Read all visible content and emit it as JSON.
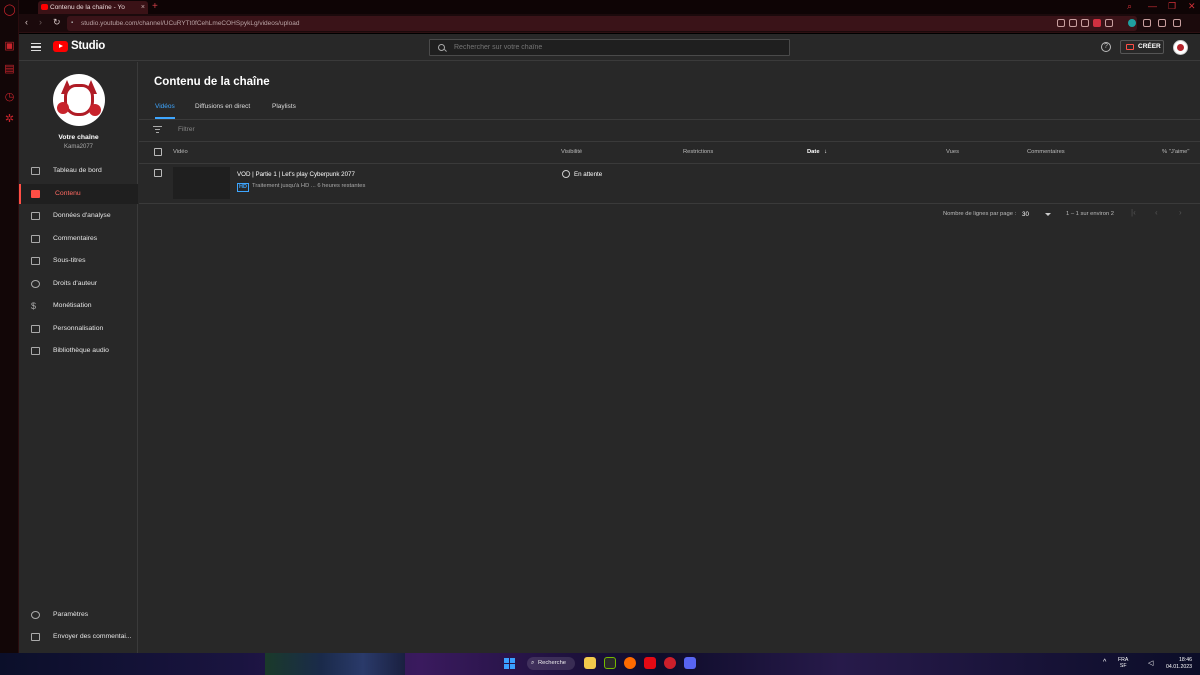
{
  "browser": {
    "tab_title": "Contenu de la chaîne - Yo",
    "tab_close": "×",
    "new_tab": "+",
    "url": "studio.youtube.com/channel/UCuRYTt0fCehLmeCOHSpykLg/videos/upload"
  },
  "header": {
    "logo_text": "Studio",
    "search_placeholder": "Rechercher sur votre chaîne",
    "help": "?",
    "create_label": "CRÉER"
  },
  "sidebar": {
    "channel_label": "Votre chaîne",
    "channel_handle": "Kama2077",
    "items": [
      {
        "label": "Tableau de bord",
        "icon": "dashboard-icon"
      },
      {
        "label": "Contenu",
        "icon": "content-icon"
      },
      {
        "label": "Données d'analyse",
        "icon": "analytics-icon"
      },
      {
        "label": "Commentaires",
        "icon": "comments-icon"
      },
      {
        "label": "Sous-titres",
        "icon": "subtitles-icon"
      },
      {
        "label": "Droits d'auteur",
        "icon": "copyright-icon"
      },
      {
        "label": "Monétisation",
        "icon": "monetization-icon"
      },
      {
        "label": "Personnalisation",
        "icon": "customization-icon"
      },
      {
        "label": "Bibliothèque audio",
        "icon": "audio-library-icon"
      }
    ],
    "bottom_items": [
      {
        "label": "Paramètres",
        "icon": "settings-icon"
      },
      {
        "label": "Envoyer des commentai...",
        "icon": "feedback-icon"
      }
    ]
  },
  "main": {
    "title": "Contenu de la chaîne",
    "tabs": [
      {
        "label": "Vidéos"
      },
      {
        "label": "Diffusions en direct"
      },
      {
        "label": "Playlists"
      }
    ],
    "filter_placeholder": "Filtrer",
    "columns": {
      "video": "Vidéo",
      "visibility": "Visibilité",
      "restrictions": "Restrictions",
      "date": "Date",
      "views": "Vues",
      "comments": "Commentaires",
      "likes": "% \"J'aime\""
    },
    "rows": [
      {
        "title": "VOD | Partie 1 | Let's play Cyberpunk 2077",
        "badge": "HD",
        "status": "Traitement jusqu'à HD ... 6 heures restantes",
        "visibility": "En attente"
      }
    ],
    "pagination": {
      "rows_label": "Nombre de lignes par page :",
      "rows_value": "30",
      "range": "1 – 1 sur environ 2"
    }
  },
  "taskbar": {
    "search_label": "Recherche",
    "lang_line1": "FRA",
    "lang_line2": "SF",
    "time": "18:46",
    "date": "04.01.2023"
  },
  "colors": {
    "accent": "#3ea6ff",
    "brand_red": "#ff0000",
    "active_nav": "#ff4e45",
    "background": "#282828"
  }
}
